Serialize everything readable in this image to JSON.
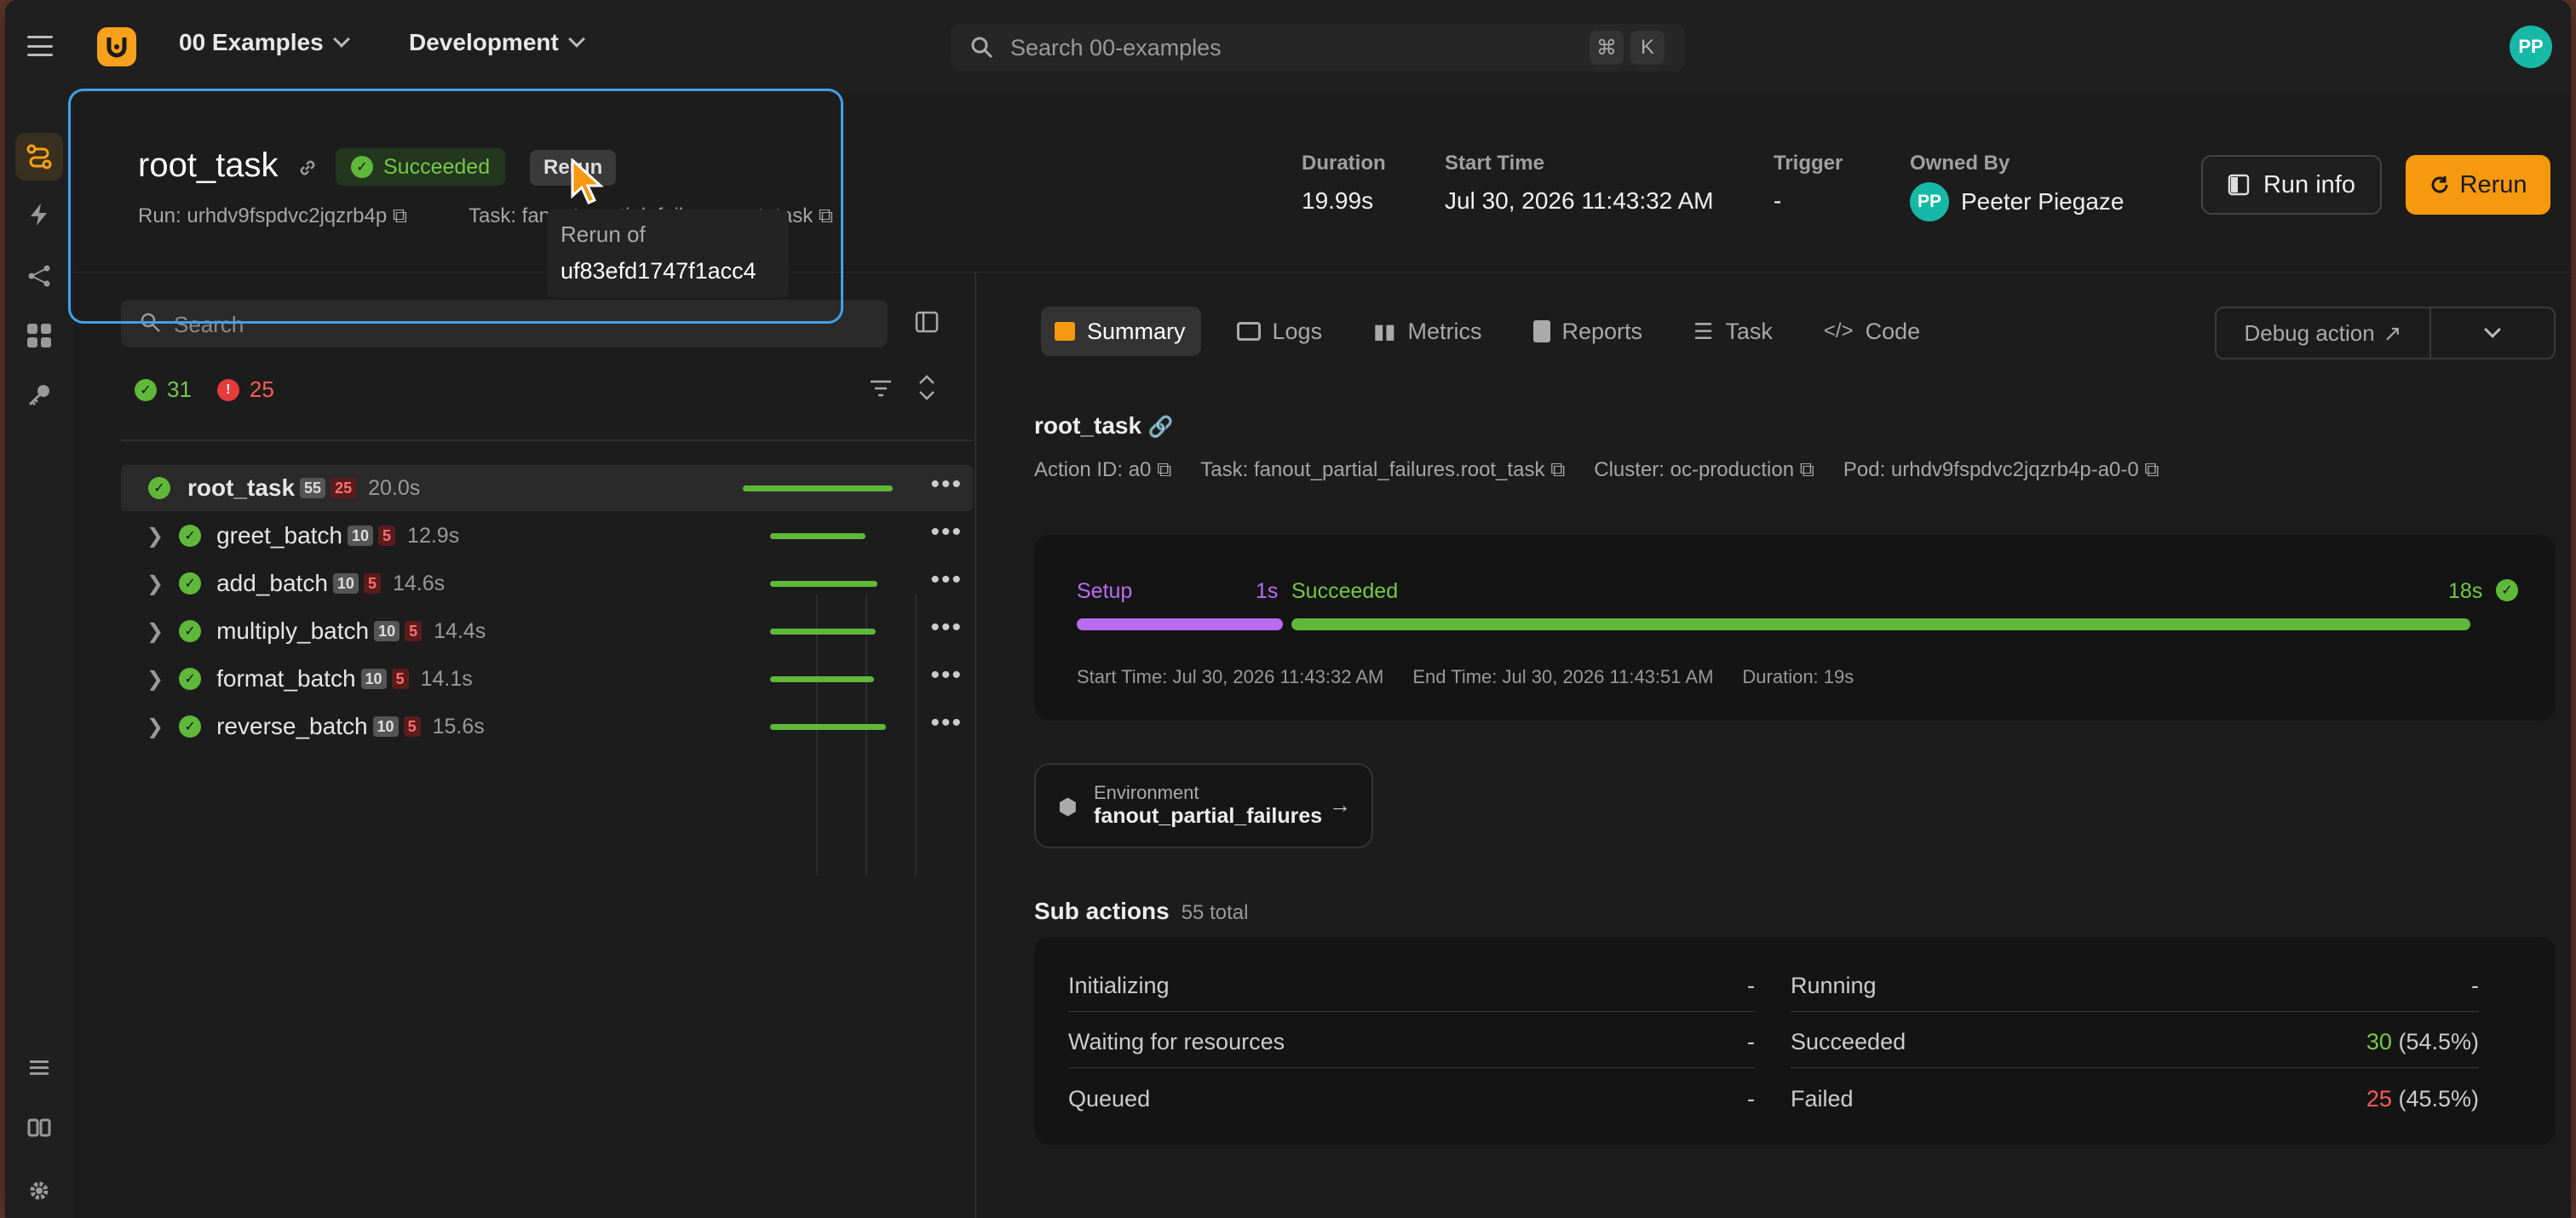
{
  "topbar": {
    "project": "00 Examples",
    "environment": "Development",
    "search_placeholder": "Search 00-examples",
    "kbd1": "⌘",
    "kbd2": "K",
    "avatar": "PP"
  },
  "header": {
    "title": "root_task",
    "status": "Succeeded",
    "rerun_small": "Rerun",
    "run_label": "Run: urhdv9fspdvc2jqzrb4p",
    "task_label": "Task: fanout_partial_failures.root_task",
    "duration_label": "Duration",
    "duration": "19.99s",
    "start_label": "Start Time",
    "start": "Jul 30, 2026 11:43:32 AM",
    "trigger_label": "Trigger",
    "trigger": "-",
    "owner_label": "Owned By",
    "owner_initials": "PP",
    "owner": "Peeter Piegaze",
    "run_info": "Run info",
    "rerun": "Rerun"
  },
  "tooltip": {
    "line1": "Rerun of",
    "line2": "uf83efd1747f1acc4"
  },
  "left": {
    "search_placeholder": "Search",
    "ok_count": "31",
    "err_count": "25",
    "rows": [
      {
        "name": "root_task",
        "ok": "55",
        "err": "25",
        "dur": "20.0s"
      },
      {
        "name": "greet_batch",
        "ok": "10",
        "err": "5",
        "dur": "12.9s"
      },
      {
        "name": "add_batch",
        "ok": "10",
        "err": "5",
        "dur": "14.6s"
      },
      {
        "name": "multiply_batch",
        "ok": "10",
        "err": "5",
        "dur": "14.4s"
      },
      {
        "name": "format_batch",
        "ok": "10",
        "err": "5",
        "dur": "14.1s"
      },
      {
        "name": "reverse_batch",
        "ok": "10",
        "err": "5",
        "dur": "15.6s"
      }
    ]
  },
  "tabs": [
    "Summary",
    "Logs",
    "Metrics",
    "Reports",
    "Task",
    "Code"
  ],
  "debug": "Debug action",
  "summary": {
    "title": "root_task",
    "action_id": "Action ID: a0",
    "task": "Task: fanout_partial_failures.root_task",
    "cluster": "Cluster: oc-production",
    "pod": "Pod: urhdv9fspdvc2jqzrb4p-a0-0"
  },
  "timeline": {
    "setup": "Setup",
    "setup_dur": "1s",
    "succeeded": "Succeeded",
    "succ_dur": "18s",
    "start": "Start Time: Jul 30, 2026 11:43:32 AM",
    "end": "End Time: Jul 30, 2026 11:43:51 AM",
    "duration": "Duration: 19s",
    "setup_color": "#b96cf0",
    "succ_color": "#5fb83a"
  },
  "environment": {
    "label": "Environment",
    "value": "fanout_partial_failures"
  },
  "sub_actions": {
    "title": "Sub actions",
    "total": "55 total",
    "left": [
      {
        "k": "Initializing",
        "v": "-"
      },
      {
        "k": "Waiting for resources",
        "v": "-"
      },
      {
        "k": "Queued",
        "v": "-"
      }
    ],
    "right": [
      {
        "k": "Running",
        "v": "-",
        "n": "",
        "p": ""
      },
      {
        "k": "Succeeded",
        "n": "30",
        "p": "(54.5%)"
      },
      {
        "k": "Failed",
        "n": "25",
        "p": "(45.5%)"
      }
    ]
  }
}
